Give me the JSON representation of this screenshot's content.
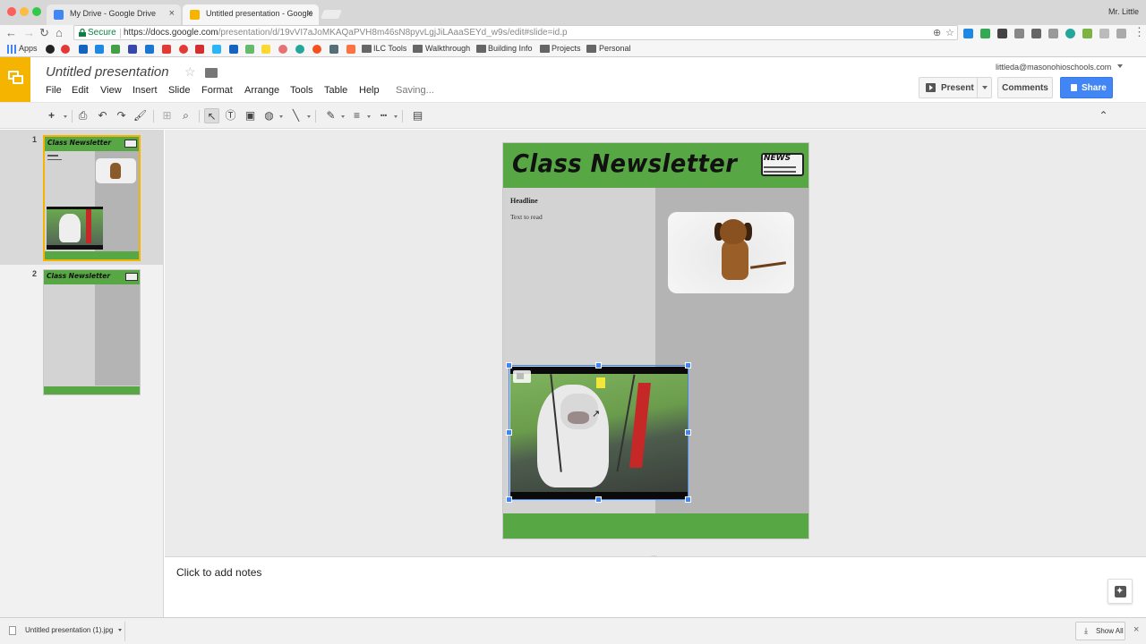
{
  "browser": {
    "tabs": [
      {
        "title": "My Drive - Google Drive"
      },
      {
        "title": "Untitled presentation - Google"
      }
    ],
    "profile": "Mr. Little",
    "secure_label": "Secure",
    "url_host": "https://docs.google.com",
    "url_path": "/presentation/d/19vVI7aJoMKAQaPVH8m46sN8pyvLgjJiLAaaSEYd_w9s/edit#slide=id.p",
    "bookmarks": {
      "apps_label": "Apps",
      "folders": [
        "ILC Tools",
        "Walkthrough",
        "Building Info",
        "Projects",
        "Personal"
      ]
    }
  },
  "app": {
    "doc_title": "Untitled presentation",
    "menu": [
      "File",
      "Edit",
      "View",
      "Insert",
      "Slide",
      "Format",
      "Arrange",
      "Tools",
      "Table",
      "Help"
    ],
    "saving_status": "Saving...",
    "user_email": "littleda@masonohioschools.com",
    "present_label": "Present",
    "comments_label": "Comments",
    "share_label": "Share"
  },
  "filmstrip": {
    "slides": [
      {
        "number": "1",
        "title": "Class Newsletter"
      },
      {
        "number": "2",
        "title": "Class Newsletter"
      }
    ]
  },
  "slide": {
    "title": "Class Newsletter",
    "news_label": "NEWS",
    "headline": "Headline",
    "body": "Text to read"
  },
  "notes": {
    "placeholder": "Click to add notes"
  },
  "downloads": {
    "file_name": "Untitled presentation (1).jpg",
    "show_all": "Show All"
  },
  "colors": {
    "slides_yellow": "#f4b400",
    "share_blue": "#4285f4",
    "slide_green": "#57a844"
  }
}
